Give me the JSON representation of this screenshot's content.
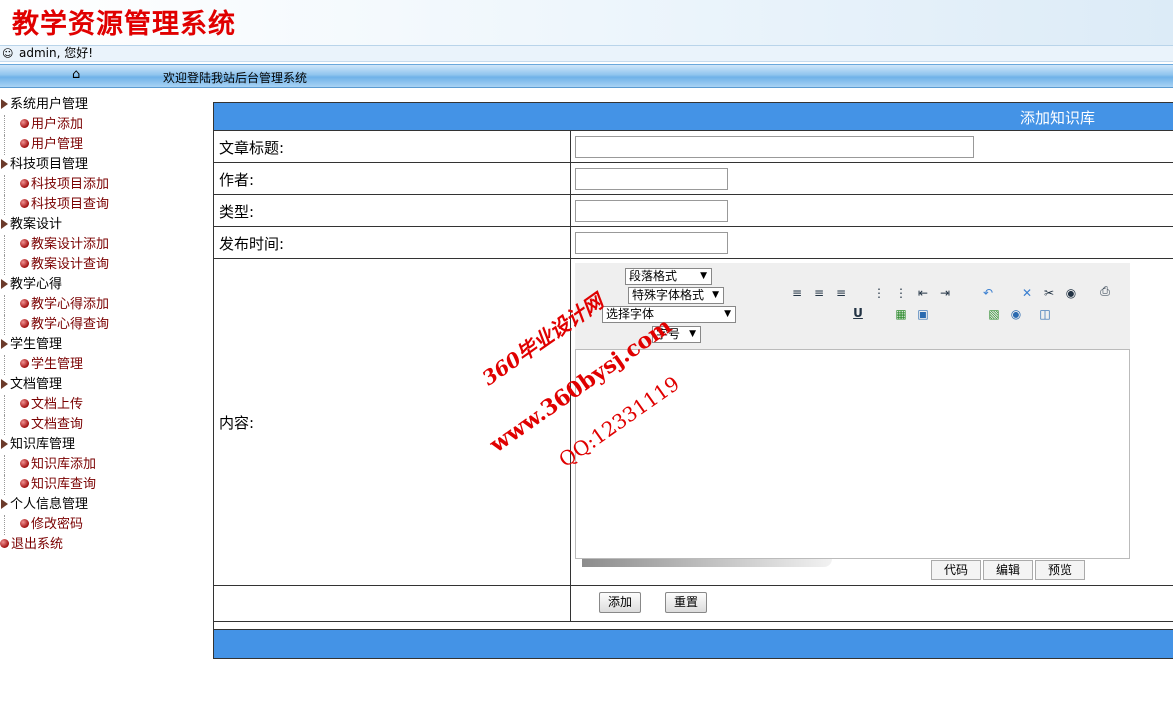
{
  "header": {
    "title": "教学资源管理系统"
  },
  "userbar": {
    "greeting": "admin, 您好!"
  },
  "navbar": {
    "welcome": "欢迎登陆我站后台管理系统"
  },
  "sidebar": {
    "groups": [
      {
        "label": "系统用户管理",
        "children": [
          "用户添加",
          "用户管理"
        ]
      },
      {
        "label": "科技项目管理",
        "children": [
          "科技项目添加",
          "科技项目查询"
        ]
      },
      {
        "label": "教案设计",
        "children": [
          "教案设计添加",
          "教案设计查询"
        ]
      },
      {
        "label": "教学心得",
        "children": [
          "教学心得添加",
          "教学心得查询"
        ]
      },
      {
        "label": "学生管理",
        "children": [
          "学生管理"
        ]
      },
      {
        "label": "文档管理",
        "children": [
          "文档上传",
          "文档查询"
        ]
      },
      {
        "label": "知识库管理",
        "children": [
          "知识库添加",
          "知识库查询"
        ]
      },
      {
        "label": "个人信息管理",
        "children": [
          "修改密码"
        ]
      }
    ],
    "logout": "退出系统"
  },
  "form": {
    "heading": "添加知识库",
    "fields": {
      "title_label": "文章标题:",
      "title_value": "",
      "author_label": "作者:",
      "author_value": "",
      "type_label": "类型:",
      "type_value": "",
      "date_label": "发布时间:",
      "date_value": "",
      "content_label": "内容:"
    },
    "editor": {
      "paragraph_format": "段落格式",
      "special_format": "特殊字体格式",
      "font": "选择字体",
      "size": "字号",
      "modes": [
        "代码",
        "编辑",
        "预览"
      ]
    },
    "buttons": {
      "add": "添加",
      "reset": "重置"
    }
  },
  "watermark": {
    "line1": "360毕业设计网",
    "line2": "www.360bysj.com",
    "line3": "QQ:12331119"
  }
}
